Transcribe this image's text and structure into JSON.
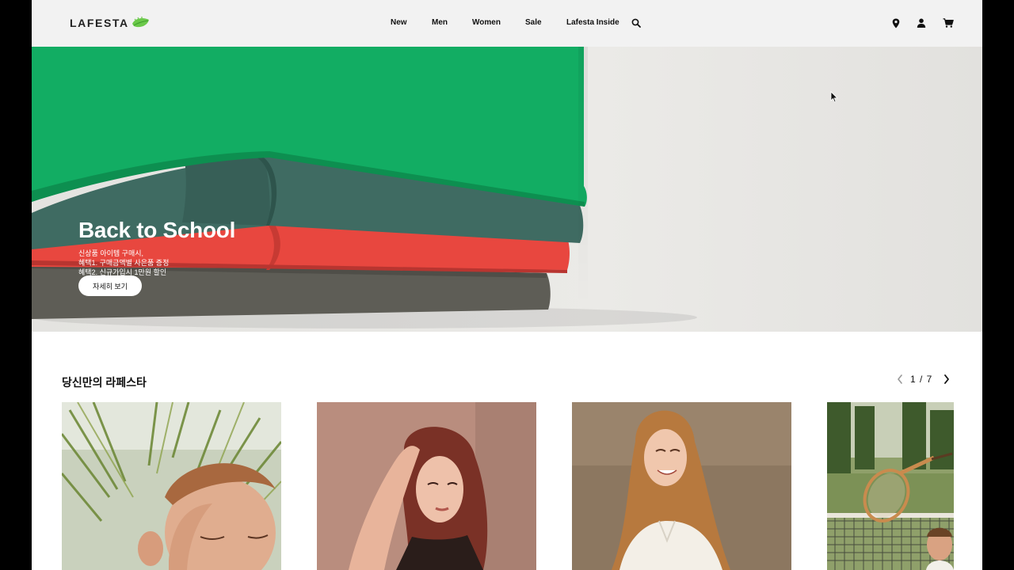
{
  "header": {
    "logo": "LAFESTA",
    "nav": [
      "New",
      "Men",
      "Women",
      "Sale",
      "Lafesta Inside"
    ]
  },
  "hero": {
    "title": "Back to School",
    "lines": [
      "신상품 아이템 구매시,",
      "혜택1. 구매금액별 사은품 증정",
      "혜택2. 신규가입시 1만원 할인"
    ],
    "button": "자세히 보기"
  },
  "section": {
    "title": "당신만의 라페스타",
    "pager": "1 / 7"
  },
  "colors": {
    "header_bg": "#f2f2f2",
    "green_shirt": "#0fae62",
    "teal_shirt": "#3e6b62",
    "red_shirt": "#e8473f",
    "grey_shirt": "#606059"
  }
}
